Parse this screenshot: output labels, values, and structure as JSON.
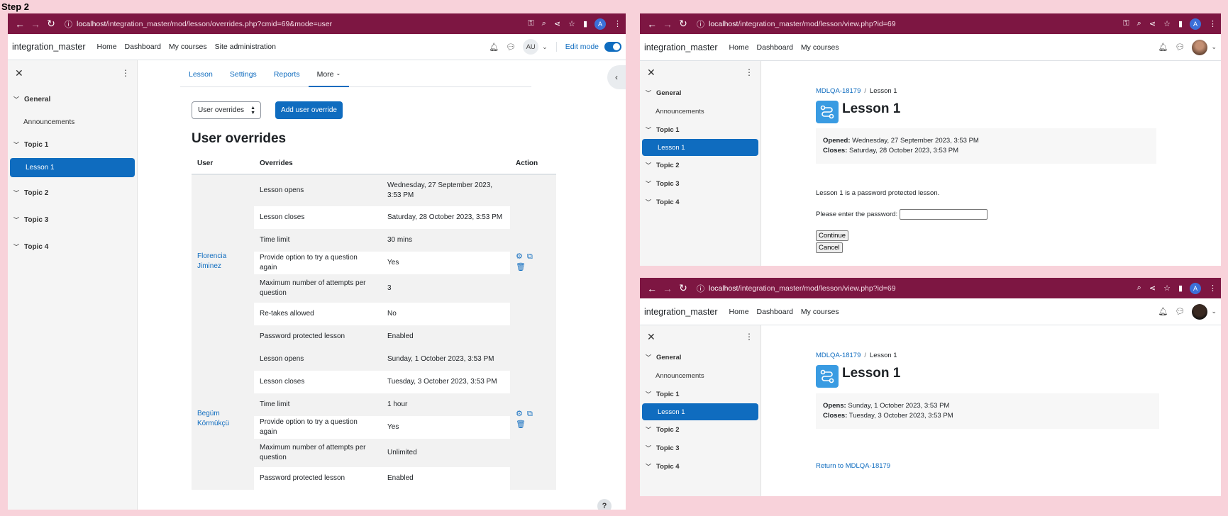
{
  "step_label": "Step 2",
  "left": {
    "url_host": "localhost",
    "url_path": "/integration_master/mod/lesson/overrides.php?cmid=69&mode=user",
    "profile_initial": "A",
    "brand": "integration_master",
    "nav": [
      "Home",
      "Dashboard",
      "My courses",
      "Site administration"
    ],
    "user_initials": "AU",
    "edit_mode": "Edit mode",
    "drawer": {
      "sections": [
        {
          "label": "General",
          "items": [
            "Announcements"
          ]
        },
        {
          "label": "Topic 1",
          "items": [
            "Lesson 1"
          ]
        },
        {
          "label": "Topic 2",
          "items": []
        },
        {
          "label": "Topic 3",
          "items": []
        },
        {
          "label": "Topic 4",
          "items": []
        }
      ]
    },
    "tabs": [
      "Lesson",
      "Settings",
      "Reports",
      "More"
    ],
    "select_value": "User overrides",
    "add_button": "Add user override",
    "heading": "User overrides",
    "headers": [
      "User",
      "Overrides",
      "Action"
    ],
    "users": [
      {
        "name_line1": "Florencia",
        "name_line2": "Jiminez",
        "rows": [
          [
            "Lesson opens",
            "Wednesday, 27 September 2023,",
            "3:53 PM"
          ],
          [
            "Lesson closes",
            "Saturday, 28 October 2023, 3:53 PM",
            ""
          ],
          [
            "Time limit",
            "30 mins",
            ""
          ],
          [
            "Provide option to try a question again",
            "Yes",
            ""
          ],
          [
            "Maximum number of attempts per",
            "3",
            "question"
          ],
          [
            "Re-takes allowed",
            "No",
            ""
          ],
          [
            "Password protected lesson",
            "Enabled",
            ""
          ]
        ]
      },
      {
        "name_line1": "Begüm",
        "name_line2": "Körmükçü",
        "rows": [
          [
            "Lesson opens",
            "Sunday, 1 October 2023, 3:53 PM",
            ""
          ],
          [
            "Lesson closes",
            "Tuesday, 3 October 2023, 3:53 PM",
            ""
          ],
          [
            "Time limit",
            "1 hour",
            ""
          ],
          [
            "Provide option to try a question again",
            "Yes",
            ""
          ],
          [
            "Maximum number of attempts per",
            "Unlimited",
            "question"
          ],
          [
            "Password protected lesson",
            "Enabled",
            ""
          ]
        ]
      }
    ],
    "help": "?"
  },
  "top_right": {
    "url_host": "localhost",
    "url_path": "/integration_master/mod/lesson/view.php?id=69",
    "profile_initial": "A",
    "brand": "integration_master",
    "nav": [
      "Home",
      "Dashboard",
      "My courses"
    ],
    "crumb": [
      "MDLQA-18179",
      "Lesson 1"
    ],
    "title": "Lesson 1",
    "opened_label": "Opened:",
    "opened_value": "Wednesday, 27 September 2023, 3:53 PM",
    "closes_label": "Closes:",
    "closes_value": "Saturday, 28 October 2023, 3:53 PM",
    "notice": "Lesson 1 is a password protected lesson.",
    "password_label": "Please enter the password:",
    "continue": "Continue",
    "cancel": "Cancel"
  },
  "bottom_right": {
    "url_host": "localhost",
    "url_path": "/integration_master/mod/lesson/view.php?id=69",
    "profile_initial": "A",
    "brand": "integration_master",
    "nav": [
      "Home",
      "Dashboard",
      "My courses"
    ],
    "crumb": [
      "MDLQA-18179",
      "Lesson 1"
    ],
    "title": "Lesson 1",
    "opens_label": "Opens:",
    "opens_value": "Sunday, 1 October 2023, 3:53 PM",
    "closes_label": "Closes:",
    "closes_value": "Tuesday, 3 October 2023, 3:53 PM",
    "return_link": "Return to MDLQA-18179"
  }
}
